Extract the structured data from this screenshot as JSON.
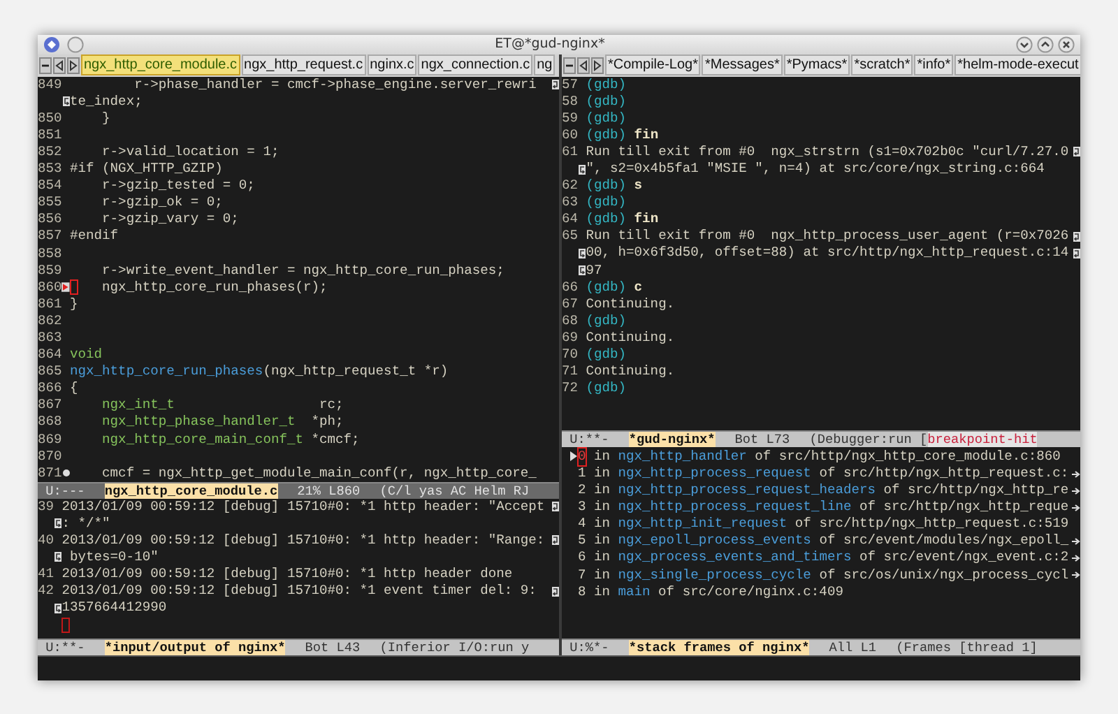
{
  "window": {
    "title": "ET@*gud-nginx*"
  },
  "left_tabs": [
    {
      "label": "ngx_http_core_module.c",
      "selected": true
    },
    {
      "label": "ngx_http_request.c",
      "selected": false
    },
    {
      "label": "nginx.c",
      "selected": false
    },
    {
      "label": "ngx_connection.c",
      "selected": false
    },
    {
      "label": "ng",
      "selected": false
    }
  ],
  "right_tabs": [
    {
      "label": "*Compile-Log*",
      "selected": false
    },
    {
      "label": "*Messages*",
      "selected": false
    },
    {
      "label": "*Pymacs*",
      "selected": false
    },
    {
      "label": "*scratch*",
      "selected": false
    },
    {
      "label": "*info*",
      "selected": false
    },
    {
      "label": "*helm-mode-execut",
      "selected": false
    }
  ],
  "code": {
    "lines": [
      {
        "number": "849",
        "segments": [
          {
            "text": "        r->phase_handler = cmcf->phase_engine.server_rewri",
            "kind": "plain"
          }
        ],
        "continuation": [
          "te_index;"
        ]
      },
      {
        "number": "850",
        "segments": [
          {
            "text": "    }",
            "kind": "plain"
          }
        ]
      },
      {
        "number": "851"
      },
      {
        "number": "852",
        "segments": [
          {
            "text": "    r->valid_location = 1;",
            "kind": "plain"
          }
        ]
      },
      {
        "number": "853",
        "segments": [
          {
            "text": "#if (NGX_HTTP_GZIP)",
            "kind": "plain"
          }
        ]
      },
      {
        "number": "854",
        "segments": [
          {
            "text": "    r->gzip_tested = 0;",
            "kind": "plain"
          }
        ]
      },
      {
        "number": "855",
        "segments": [
          {
            "text": "    r->gzip_ok = 0;",
            "kind": "plain"
          }
        ]
      },
      {
        "number": "856",
        "segments": [
          {
            "text": "    r->gzip_vary = 0;",
            "kind": "plain"
          }
        ]
      },
      {
        "number": "857",
        "segments": [
          {
            "text": "#endif",
            "kind": "plain"
          }
        ]
      },
      {
        "number": "858"
      },
      {
        "number": "859",
        "segments": [
          {
            "text": "    r->write_event_handler = ngx_http_core_run_phases;",
            "kind": "plain"
          }
        ]
      },
      {
        "number": "860",
        "breakpoint": true,
        "cursor": true,
        "segments": [
          {
            "text": "    ngx_http_core_run_phases(r);",
            "kind": "plain"
          }
        ]
      },
      {
        "number": "861",
        "segments": [
          {
            "text": "}",
            "kind": "plain"
          }
        ]
      },
      {
        "number": "862"
      },
      {
        "number": "863"
      },
      {
        "number": "864",
        "segments": [
          {
            "text": "void",
            "kind": "type"
          }
        ]
      },
      {
        "number": "865",
        "segments": [
          {
            "text": "ngx_http_core_run_phases",
            "kind": "function"
          },
          {
            "text": "(ngx_http_request_t *r)",
            "kind": "plain"
          }
        ]
      },
      {
        "number": "866",
        "segments": [
          {
            "text": "{",
            "kind": "plain"
          }
        ]
      },
      {
        "number": "867",
        "segments": [
          {
            "text": "    ngx_int_t",
            "kind": "type"
          },
          {
            "text": "                  rc;",
            "kind": "plain"
          }
        ]
      },
      {
        "number": "868",
        "segments": [
          {
            "text": "    ngx_http_phase_handler_t",
            "kind": "type"
          },
          {
            "text": "  *ph;",
            "kind": "plain"
          }
        ]
      },
      {
        "number": "869",
        "segments": [
          {
            "text": "    ngx_http_core_main_conf_t",
            "kind": "type"
          },
          {
            "text": " *cmcf;",
            "kind": "plain"
          }
        ]
      },
      {
        "number": "870"
      },
      {
        "number": "871",
        "fringe_dot": true,
        "segments": [
          {
            "text": "    cmcf = ngx_http_get_module_main_conf(r, ngx_http_core_",
            "kind": "plain"
          }
        ]
      }
    ]
  },
  "code_mode_line": {
    "status": "U:---",
    "buffer": "ngx_http_core_module.c",
    "position": "21% L860",
    "modes": "(C/l yas AC Helm RJ",
    "active": false
  },
  "log": {
    "lines": [
      {
        "number": "39",
        "segments": [
          {
            "text": "2013/01/09 00:59:12 [debug] 15710#0: *1 http header: \"Accept",
            "kind": "plain"
          }
        ],
        "continuation": [
          ": */*\""
        ]
      },
      {
        "number": "40",
        "segments": [
          {
            "text": "2013/01/09 00:59:12 [debug] 15710#0: *1 http header: \"Range:",
            "kind": "plain"
          }
        ],
        "continuation": [
          " bytes=0-10\""
        ]
      },
      {
        "number": "41",
        "segments": [
          {
            "text": "2013/01/09 00:59:12 [debug] 15710#0: *1 http header done",
            "kind": "plain"
          }
        ]
      },
      {
        "number": "42",
        "segments": [
          {
            "text": "2013/01/09 00:59:12 [debug] 15710#0: *1 event timer del: 9: ",
            "kind": "plain"
          }
        ],
        "continuation": [
          "1357664412990"
        ]
      }
    ],
    "cursor": true
  },
  "log_mode_line": {
    "status": "U:**-",
    "buffer": "*input/output of nginx*",
    "position": "Bot L43",
    "modes": "(Inferior I/O:run y",
    "active": true
  },
  "gdb": {
    "lines": [
      {
        "number": "57",
        "segments": [
          {
            "text": "(gdb)",
            "kind": "prompt"
          }
        ]
      },
      {
        "number": "58",
        "segments": [
          {
            "text": "(gdb)",
            "kind": "prompt"
          }
        ]
      },
      {
        "number": "59",
        "segments": [
          {
            "text": "(gdb)",
            "kind": "prompt"
          }
        ]
      },
      {
        "number": "60",
        "segments": [
          {
            "text": "(gdb)",
            "kind": "prompt"
          },
          {
            "text": " fin",
            "kind": "command"
          }
        ]
      },
      {
        "number": "61",
        "segments": [
          {
            "text": "Run till exit from #0  ngx_strstrn (s1=0x702b0c \"curl/7.27.0",
            "kind": "plain"
          }
        ],
        "continuation": [
          "\", s2=0x4b5fa1 \"MSIE \", n=4) at src/core/ngx_string.c:664"
        ]
      },
      {
        "number": "62",
        "segments": [
          {
            "text": "(gdb)",
            "kind": "prompt"
          },
          {
            "text": " s",
            "kind": "command"
          }
        ]
      },
      {
        "number": "63",
        "segments": [
          {
            "text": "(gdb)",
            "kind": "prompt"
          }
        ]
      },
      {
        "number": "64",
        "segments": [
          {
            "text": "(gdb)",
            "kind": "prompt"
          },
          {
            "text": " fin",
            "kind": "command"
          }
        ]
      },
      {
        "number": "65",
        "segments": [
          {
            "text": "Run till exit from #0  ngx_http_process_user_agent (r=0x7026",
            "kind": "plain"
          }
        ],
        "continuation": [
          "00, h=0x6f3d50, offset=88) at src/http/ngx_http_request.c:14",
          "97"
        ]
      },
      {
        "number": "66",
        "segments": [
          {
            "text": "(gdb)",
            "kind": "prompt"
          },
          {
            "text": " c",
            "kind": "command"
          }
        ]
      },
      {
        "number": "67",
        "segments": [
          {
            "text": "Continuing.",
            "kind": "plain"
          }
        ]
      },
      {
        "number": "68",
        "segments": [
          {
            "text": "(gdb)",
            "kind": "prompt"
          }
        ]
      },
      {
        "number": "69",
        "segments": [
          {
            "text": "Continuing.",
            "kind": "plain"
          }
        ]
      },
      {
        "number": "70",
        "segments": [
          {
            "text": "(gdb)",
            "kind": "prompt"
          }
        ]
      },
      {
        "number": "71",
        "segments": [
          {
            "text": "Continuing.",
            "kind": "plain"
          }
        ]
      },
      {
        "number": "72",
        "segments": [
          {
            "text": "(gdb)",
            "kind": "prompt"
          }
        ]
      }
    ]
  },
  "gdb_mode_line": {
    "status": "U:**-",
    "buffer": "*gud-nginx*",
    "position": "Bot L73",
    "modes": "(Debugger:run [",
    "flag": "breakpoint-hit",
    "active": true
  },
  "stack": {
    "frames": [
      {
        "number": "0",
        "selected": true,
        "truncated": false,
        "segments": [
          {
            "text": "in",
            "kind": "plain"
          },
          {
            "text": "ngx_http_handler",
            "kind": "function"
          },
          {
            "text": "of",
            "kind": "plain"
          },
          {
            "text": "src/http/ngx_http_core_module.c:860",
            "kind": "plain"
          }
        ]
      },
      {
        "number": "1",
        "selected": false,
        "truncated": true,
        "segments": [
          {
            "text": "in",
            "kind": "plain"
          },
          {
            "text": "ngx_http_process_request",
            "kind": "function"
          },
          {
            "text": "of",
            "kind": "plain"
          },
          {
            "text": "src/http/ngx_http_request.c:",
            "kind": "plain"
          }
        ]
      },
      {
        "number": "2",
        "selected": false,
        "truncated": true,
        "segments": [
          {
            "text": "in",
            "kind": "plain"
          },
          {
            "text": "ngx_http_process_request_headers",
            "kind": "function"
          },
          {
            "text": "of",
            "kind": "plain"
          },
          {
            "text": "src/http/ngx_http_re",
            "kind": "plain"
          }
        ]
      },
      {
        "number": "3",
        "selected": false,
        "truncated": true,
        "segments": [
          {
            "text": "in",
            "kind": "plain"
          },
          {
            "text": "ngx_http_process_request_line",
            "kind": "function"
          },
          {
            "text": "of",
            "kind": "plain"
          },
          {
            "text": "src/http/ngx_http_reque",
            "kind": "plain"
          }
        ]
      },
      {
        "number": "4",
        "selected": false,
        "truncated": false,
        "segments": [
          {
            "text": "in",
            "kind": "plain"
          },
          {
            "text": "ngx_http_init_request",
            "kind": "function"
          },
          {
            "text": "of",
            "kind": "plain"
          },
          {
            "text": "src/http/ngx_http_request.c:519",
            "kind": "plain"
          }
        ]
      },
      {
        "number": "5",
        "selected": false,
        "truncated": true,
        "segments": [
          {
            "text": "in",
            "kind": "plain"
          },
          {
            "text": "ngx_epoll_process_events",
            "kind": "function"
          },
          {
            "text": "of",
            "kind": "plain"
          },
          {
            "text": "src/event/modules/ngx_epoll_",
            "kind": "plain"
          }
        ]
      },
      {
        "number": "6",
        "selected": false,
        "truncated": true,
        "segments": [
          {
            "text": "in",
            "kind": "plain"
          },
          {
            "text": "ngx_process_events_and_timers",
            "kind": "function"
          },
          {
            "text": "of",
            "kind": "plain"
          },
          {
            "text": "src/event/ngx_event.c:2",
            "kind": "plain"
          }
        ]
      },
      {
        "number": "7",
        "selected": false,
        "truncated": true,
        "segments": [
          {
            "text": "in",
            "kind": "plain"
          },
          {
            "text": "ngx_single_process_cycle",
            "kind": "function"
          },
          {
            "text": "of",
            "kind": "plain"
          },
          {
            "text": "src/os/unix/ngx_process_cycl",
            "kind": "plain"
          }
        ]
      },
      {
        "number": "8",
        "selected": false,
        "truncated": false,
        "segments": [
          {
            "text": "in",
            "kind": "plain"
          },
          {
            "text": "main",
            "kind": "function"
          },
          {
            "text": "of",
            "kind": "plain"
          },
          {
            "text": "src/core/nginx.c:409",
            "kind": "plain"
          }
        ]
      }
    ]
  },
  "stack_mode_line": {
    "status": "U:%*-",
    "buffer": "*stack frames of nginx*",
    "position": "All L1",
    "modes": "(Frames [thread 1]",
    "active": true
  }
}
